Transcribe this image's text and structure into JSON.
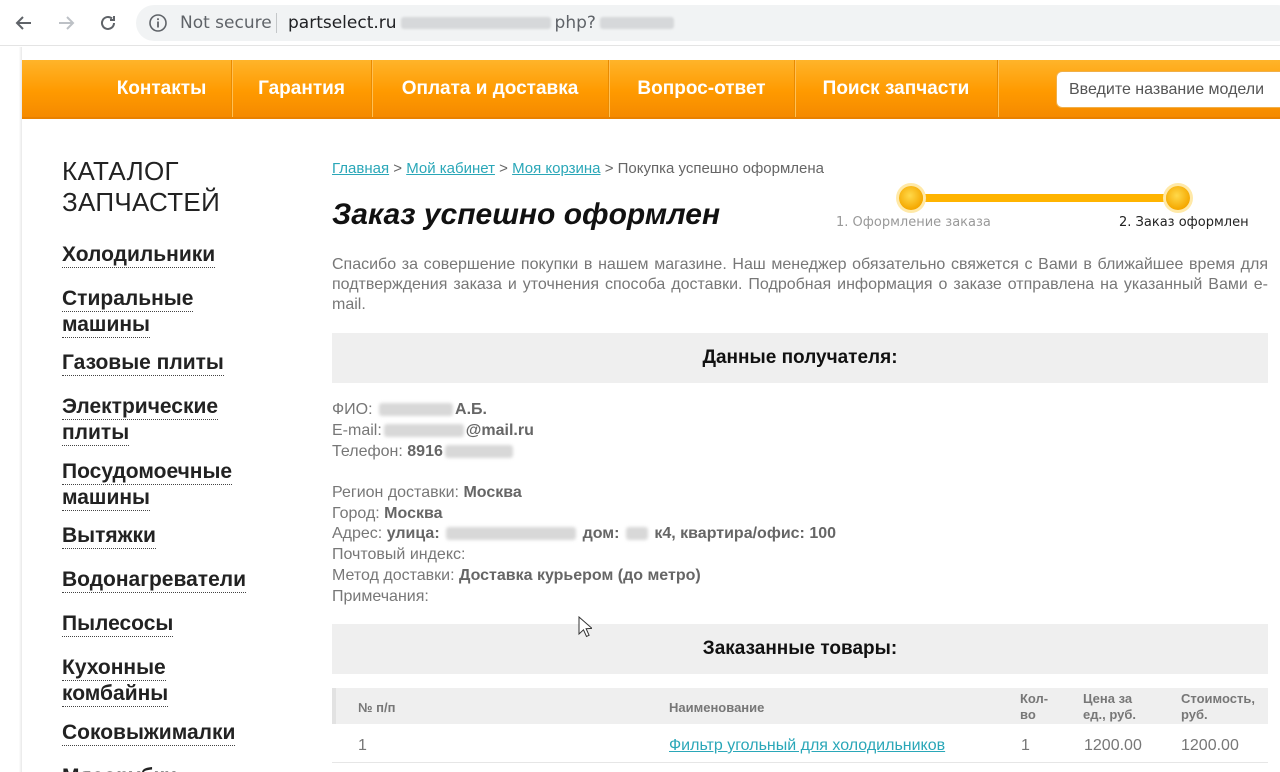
{
  "browser": {
    "security_label": "Not secure",
    "url_host": "partselect.ru",
    "url_tail": "php?"
  },
  "menu": {
    "items": [
      "Контакты",
      "Гарантия",
      "Оплата и доставка",
      "Вопрос-ответ",
      "Поиск запчасти"
    ],
    "search_placeholder": "Введите название модели"
  },
  "sidebar": {
    "title_line1": "КАТАЛОГ",
    "title_line2": "ЗАПЧАСТЕЙ",
    "items": [
      [
        "Холодильники"
      ],
      [
        "Стиральные",
        "машины"
      ],
      [
        "Газовые плиты"
      ],
      [
        "Электрические",
        "плиты"
      ],
      [
        "Посудомоечные",
        "машины"
      ],
      [
        "Вытяжки"
      ],
      [
        "Водонагреватели"
      ],
      [
        "Пылесосы"
      ],
      [
        "Кухонные",
        "комбайны"
      ],
      [
        "Соковыжималки"
      ],
      [
        "Мясорубки"
      ]
    ]
  },
  "breadcrumb": {
    "home": "Главная",
    "cabinet": "Мой кабинет",
    "cart": "Моя корзина",
    "separator": ">",
    "current": "Покупка успешно оформлена"
  },
  "page": {
    "title": "Заказ успешно оформлен",
    "intro": "Спасибо за совершение покупки в нашем магазине. Наш менеджер обязательно свяжется с Вами в ближайшее время для подтверждения заказа и уточнения способа доставки. Подробная информация о заказе отправлена на указанный Вами e-mail."
  },
  "progress": {
    "step1": "1. Оформление заказа",
    "step2": "2. Заказ оформлен"
  },
  "recipient": {
    "heading": "Данные получателя:",
    "name_label": "ФИО:",
    "name_value": "А.Б.",
    "email_label": "E-mail:",
    "email_value": "@mail.ru",
    "phone_label": "Телефон:",
    "phone_value": "8916",
    "region_label": "Регион доставки:",
    "region_value": "Москва",
    "city_label": "Город:",
    "city_value": "Москва",
    "address_label": "Адрес:",
    "address_street": "улица:",
    "address_house": "дом:",
    "address_rest": "к4, квартира/офис: 100",
    "zip_label": "Почтовый индекс:",
    "delivery_label": "Метод доставки:",
    "delivery_value": "Доставка курьером (до метро)",
    "notes_label": "Примечания:"
  },
  "order": {
    "heading": "Заказанные товары:",
    "columns": {
      "num": "№ п/п",
      "name": "Наименование",
      "qty_1": "Кол-",
      "qty_2": "во",
      "price_1": "Цена за",
      "price_2": "ед., руб.",
      "cost_1": "Стоимость,",
      "cost_2": "руб."
    },
    "rows": [
      {
        "num": "1",
        "name": "Фильтр угольный для холодильников",
        "qty": "1",
        "price": "1200.00",
        "cost": "1200.00"
      }
    ]
  },
  "colors": {
    "accent_orange": "#ff9a00",
    "link_teal": "#2aa7b8"
  }
}
